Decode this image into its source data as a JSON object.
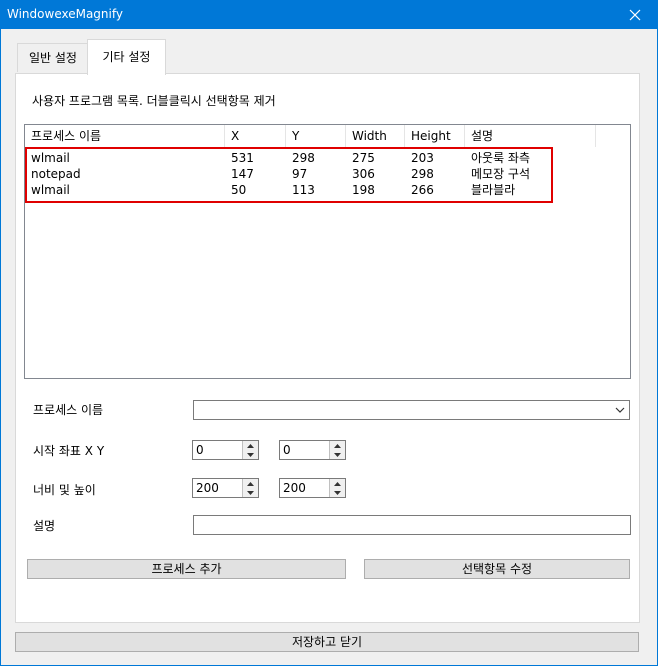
{
  "window": {
    "title": "WindowexeMagnify"
  },
  "tabs": [
    {
      "label": "일반 설정"
    },
    {
      "label": "기타 설정"
    }
  ],
  "panel": {
    "description": "사용자 프로그램 목록. 더블클릭시 선택항목 제거",
    "list": {
      "columns": [
        "프로세스 이름",
        "X",
        "Y",
        "Width",
        "Height",
        "설명"
      ],
      "rows": [
        [
          "wlmail",
          "531",
          "298",
          "275",
          "203",
          "아웃룩 좌측"
        ],
        [
          "notepad",
          "147",
          "97",
          "306",
          "298",
          "메모장 구석"
        ],
        [
          "wlmail",
          "50",
          "113",
          "198",
          "266",
          "블라블라"
        ]
      ]
    },
    "form": {
      "process_label": "프로세스 이름",
      "process_value": "",
      "start_label": "시작 좌표 X Y",
      "start_x": "0",
      "start_y": "0",
      "size_label": "너비 및 높이",
      "width": "200",
      "height": "200",
      "desc_label": "설명",
      "desc_value": ""
    },
    "buttons": {
      "add": "프로세스 추가",
      "edit": "선택항목 수정"
    }
  },
  "footer": {
    "save_close": "저장하고 닫기"
  },
  "colors": {
    "titlebar": "#0078d7",
    "highlight_box": "#e00000"
  }
}
